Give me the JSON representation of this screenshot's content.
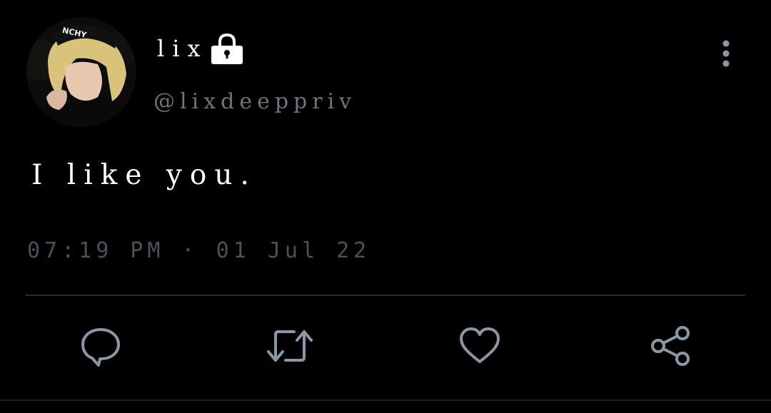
{
  "user": {
    "display_name": "lix",
    "handle": "@lixdeeppriv",
    "avatar_cap_text": "NCHY",
    "protected_icon": "lock-icon"
  },
  "tweet": {
    "text": "I like you.",
    "timestamp": "07:19 PM · 01 Jul 22"
  },
  "actions": {
    "reply_icon": "reply-icon",
    "retweet_icon": "retweet-icon",
    "like_icon": "heart-icon",
    "share_icon": "share-icon",
    "more_icon": "more-vertical-icon"
  },
  "colors": {
    "background": "#000000",
    "text_primary": "#ffffff",
    "text_secondary": "#6e767d",
    "icon": "#8899a6"
  }
}
